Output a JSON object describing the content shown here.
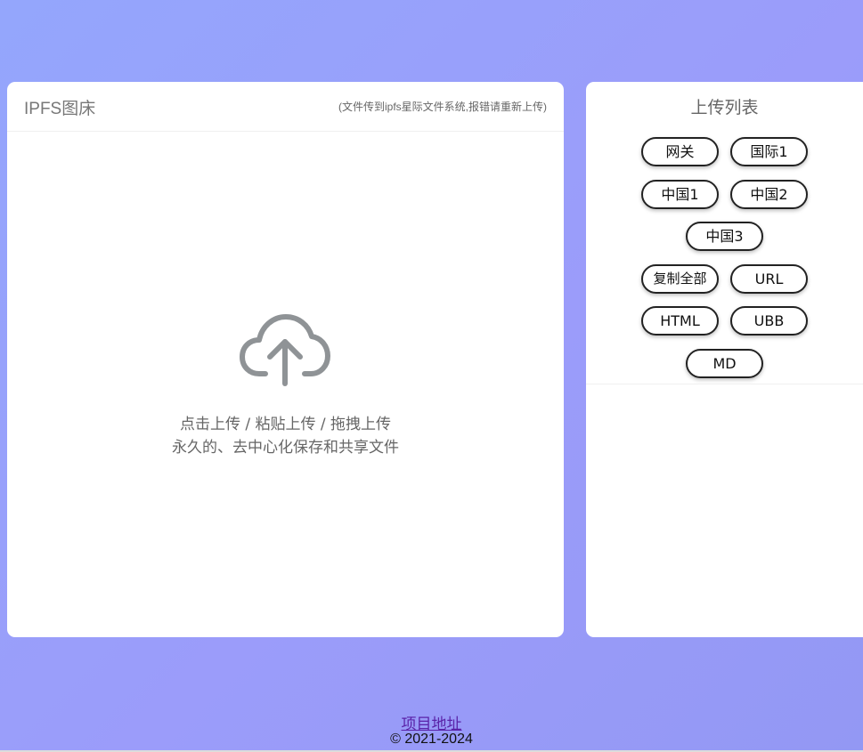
{
  "upload_panel": {
    "title": "IPFS图床",
    "note": "(文件传到ipfs星际文件系统,报错请重新上传)",
    "drop_line1": "点击上传 / 粘贴上传 / 拖拽上传",
    "drop_line2": "永久的、去中心化保存和共享文件",
    "icon": "cloud-upload-icon"
  },
  "list_panel": {
    "title": "上传列表",
    "gateway_buttons": [
      "网关",
      "国际1",
      "中国1",
      "中国2",
      "中国3"
    ],
    "format_buttons": [
      "复制全部",
      "URL",
      "HTML",
      "UBB",
      "MD"
    ]
  },
  "footer": {
    "link": "项目地址",
    "copyright": "© 2021-2024"
  },
  "colors": {
    "background": "#9b9cfa",
    "card": "#ffffff",
    "link": "#5a22a8"
  }
}
